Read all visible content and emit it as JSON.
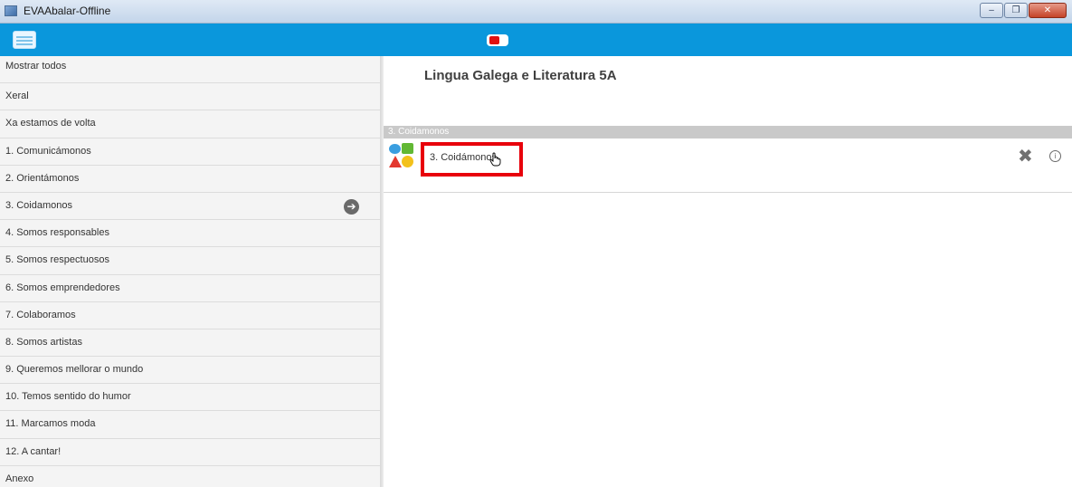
{
  "window": {
    "title": "EVAAbalar-Offline"
  },
  "window_controls": {
    "minimize": "‒",
    "maximize": "❐",
    "close": "✕"
  },
  "colors": {
    "header": "#0a97dc",
    "highlight": "#e8000b",
    "section_bar": "#c9c9c9"
  },
  "header": {
    "menu_icon": "menu-icon",
    "toggle_icon": "toggle-icon"
  },
  "sidebar": {
    "items": [
      {
        "label": "Mostrar todos"
      },
      {
        "label": "Xeral"
      },
      {
        "label": "Xa estamos de volta"
      },
      {
        "label": "1. Comunicámonos"
      },
      {
        "label": "2. Orientámonos"
      },
      {
        "label": "3. Coidamonos"
      },
      {
        "label": "4. Somos responsables"
      },
      {
        "label": "5. Somos respectuosos"
      },
      {
        "label": "6. Somos emprendedores"
      },
      {
        "label": "7. Colaboramos"
      },
      {
        "label": "8. Somos artistas"
      },
      {
        "label": "9. Queremos mellorar o mundo"
      },
      {
        "label": "10. Temos sentido do humor"
      },
      {
        "label": "11. Marcamos moda"
      },
      {
        "label": "12. A cantar!"
      },
      {
        "label": "Anexo"
      }
    ],
    "arrow_glyph": "➔"
  },
  "main": {
    "course_title": "Lingua Galega e Literatura 5A",
    "section_label": "3. Coidamonos",
    "activity": {
      "label": "3. Coidámonos",
      "icon": "shapes-icon"
    },
    "delete_glyph": "✖",
    "info_glyph": "i"
  }
}
